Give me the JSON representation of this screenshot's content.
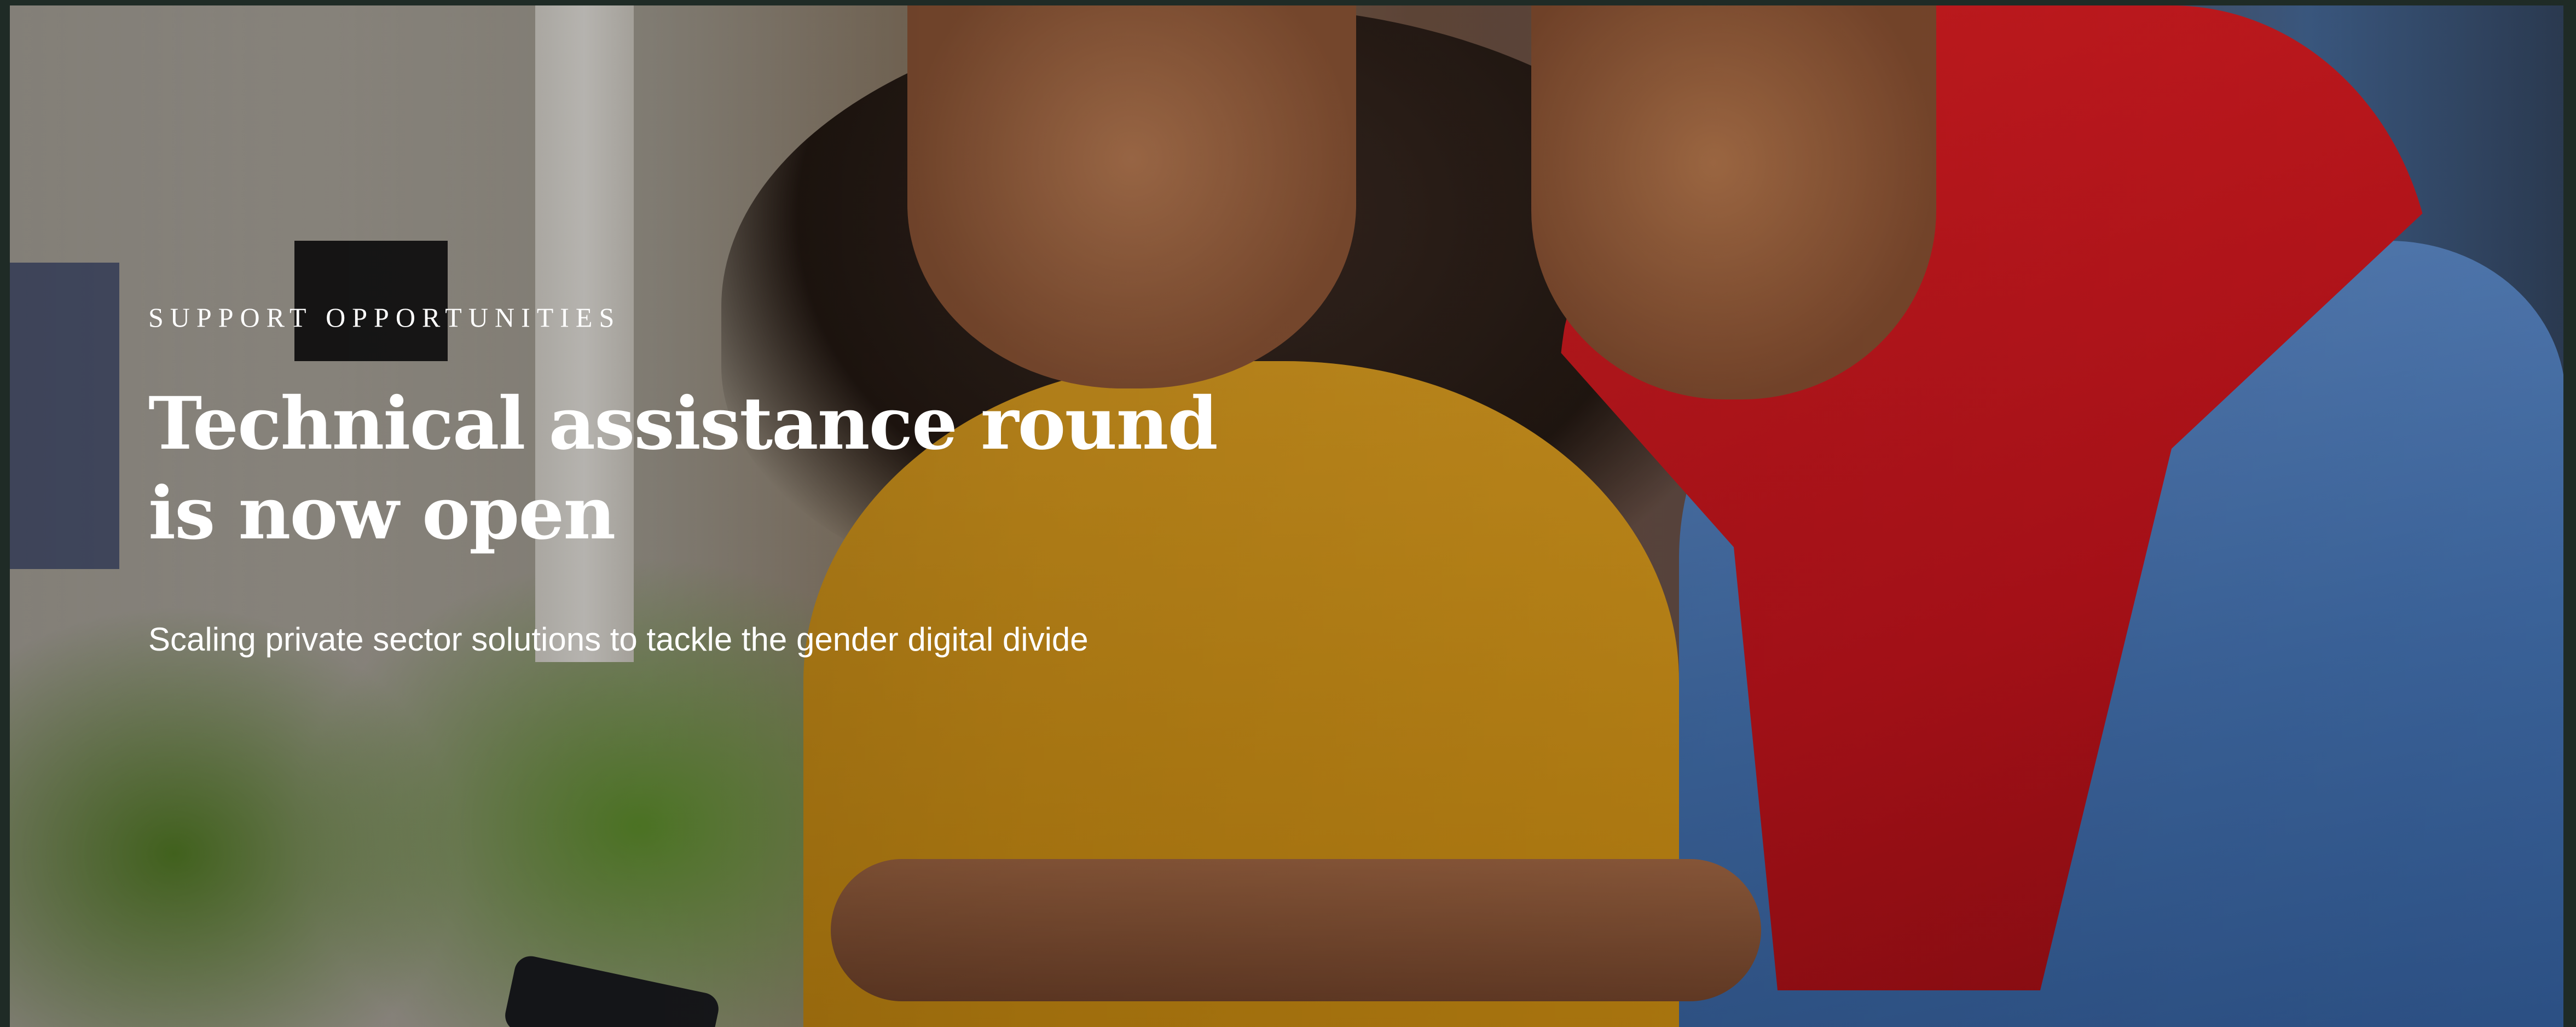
{
  "hero": {
    "eyebrow": "SUPPORT OPPORTUNITIES",
    "title": "Technical assistance round is now open",
    "subtitle": "Scaling private sector solutions to tackle the gender digital divide"
  },
  "colors": {
    "text": "#ffffff",
    "page_background": "#1f2b26"
  }
}
